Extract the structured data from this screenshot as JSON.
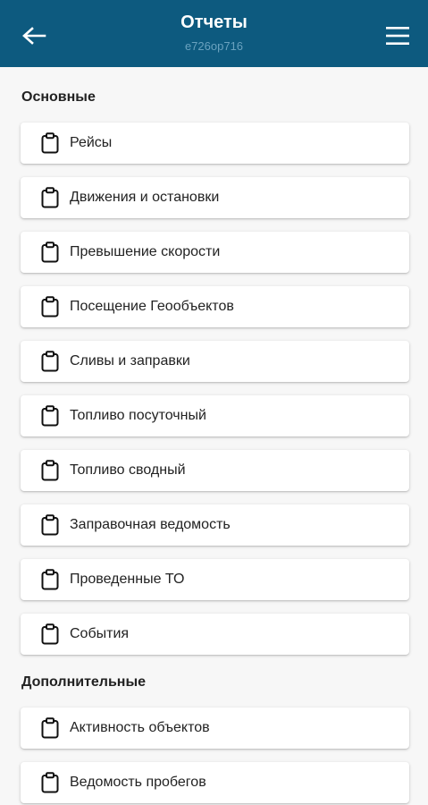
{
  "header": {
    "title": "Отчеты",
    "subtitle": "е726ор716",
    "background": "#0d5a7f",
    "back_icon": "arrow-left-icon",
    "menu_icon": "hamburger-menu-icon"
  },
  "sections": [
    {
      "title": "Основные",
      "items": [
        {
          "label": "Рейсы",
          "icon": "clipboard-icon"
        },
        {
          "label": "Движения и остановки",
          "icon": "clipboard-icon"
        },
        {
          "label": "Превышение скорости",
          "icon": "clipboard-icon"
        },
        {
          "label": "Посещение Геообъектов",
          "icon": "clipboard-icon"
        },
        {
          "label": "Сливы и заправки",
          "icon": "clipboard-icon"
        },
        {
          "label": "Топливо посуточный",
          "icon": "clipboard-icon"
        },
        {
          "label": "Топливо сводный",
          "icon": "clipboard-icon"
        },
        {
          "label": "Заправочная ведомость",
          "icon": "clipboard-icon"
        },
        {
          "label": "Проведенные ТО",
          "icon": "clipboard-icon"
        },
        {
          "label": "События",
          "icon": "clipboard-icon"
        }
      ]
    },
    {
      "title": "Дополнительные",
      "items": [
        {
          "label": "Активность объектов",
          "icon": "clipboard-icon"
        },
        {
          "label": "Ведомость пробегов",
          "icon": "clipboard-icon"
        }
      ]
    }
  ]
}
